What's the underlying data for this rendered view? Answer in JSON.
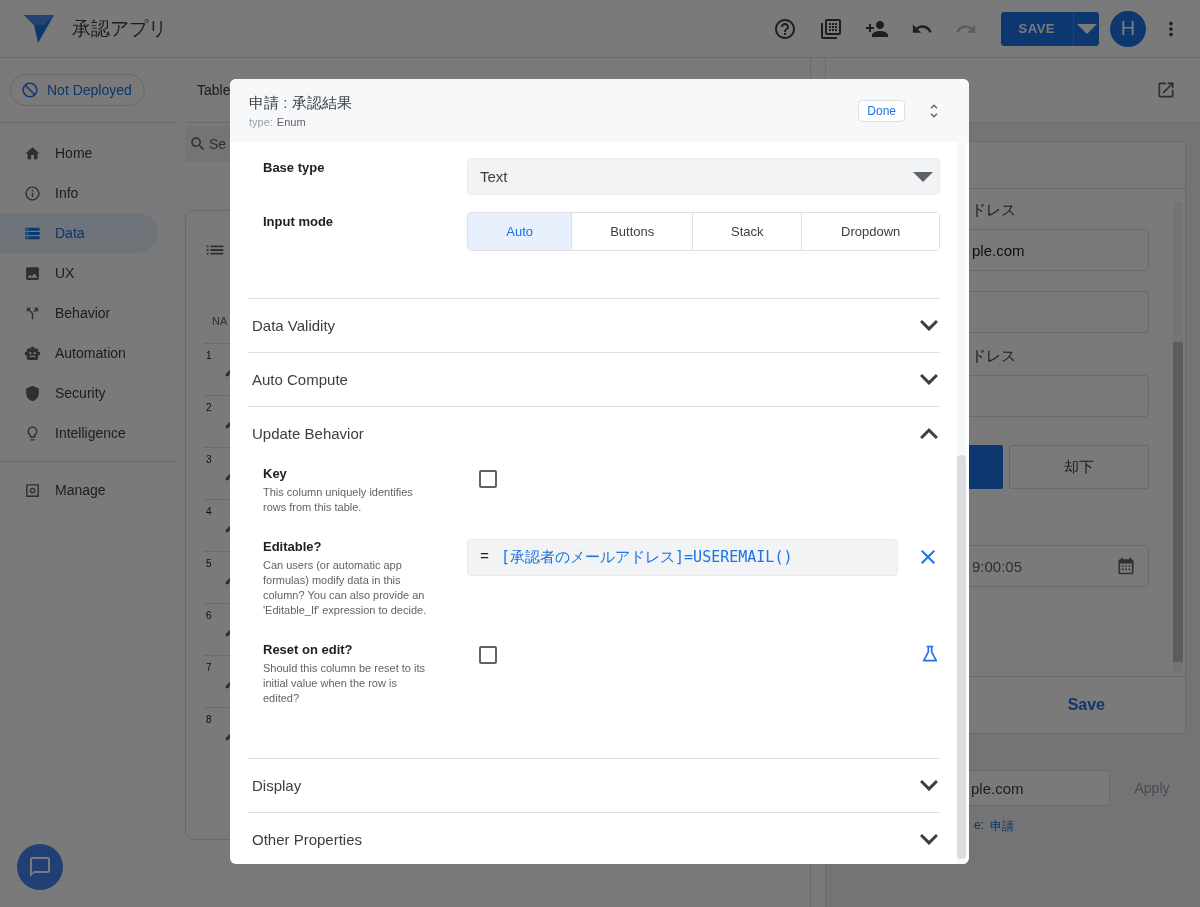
{
  "app": {
    "title": "承認アプリ",
    "save_button": "SAVE",
    "avatar": "H"
  },
  "sidebar": {
    "deploy_status": "Not Deployed",
    "items": [
      {
        "label": "Home",
        "selected": false
      },
      {
        "label": "Info",
        "selected": false
      },
      {
        "label": "Data",
        "selected": true
      },
      {
        "label": "UX",
        "selected": false
      },
      {
        "label": "Behavior",
        "selected": false
      },
      {
        "label": "Automation",
        "selected": false
      },
      {
        "label": "Security",
        "selected": false
      },
      {
        "label": "Intelligence",
        "selected": false
      }
    ],
    "footer_items": [
      {
        "label": "Manage",
        "selected": false
      }
    ]
  },
  "center": {
    "tab": "Table",
    "search": {
      "placeholder": "Se"
    },
    "table": {
      "column_1": "NA",
      "row_numbers": [
        "1",
        "2",
        "3",
        "4",
        "5",
        "6",
        "7",
        "8"
      ]
    }
  },
  "preview": {
    "form": [
      {
        "kind": "label",
        "text": "ドレス"
      },
      {
        "kind": "field",
        "value": "ple.com"
      },
      {
        "kind": "field"
      },
      {
        "kind": "label",
        "text": "ドレス"
      },
      {
        "kind": "field"
      },
      {
        "kind": "buttons",
        "buttons": [
          {
            "selected": true
          },
          {
            "label": "却下",
            "selected": false
          }
        ]
      },
      {
        "kind": "date",
        "value": "9:00:05"
      }
    ],
    "save_button": "Save",
    "email_field": "ple.com",
    "apply_button": {
      "label": "Apply",
      "disabled": true
    },
    "table_ref_label": "e:",
    "table_ref_link": "申請"
  },
  "dialog": {
    "title": "申請 : 承認結果",
    "type_label": "type:",
    "type_value": "Enum",
    "done_button": "Done",
    "base_type": {
      "label": "Base type",
      "value": "Text"
    },
    "input_mode": {
      "label": "Input mode",
      "options": [
        {
          "label": "Auto",
          "selected": true
        },
        {
          "label": "Buttons",
          "selected": false
        },
        {
          "label": "Stack",
          "selected": false
        },
        {
          "label": "Dropdown",
          "selected": false
        }
      ]
    },
    "sections": [
      {
        "title": "Data Validity",
        "expanded": false
      },
      {
        "title": "Auto Compute",
        "expanded": false
      },
      {
        "title": "Update Behavior",
        "expanded": true,
        "settings": [
          {
            "kind": "checkbox",
            "label": "Key",
            "description": "This column uniquely identifies rows from this table.",
            "checked": false,
            "test_button": false
          },
          {
            "kind": "formula",
            "label": "Editable?",
            "description": "Can users (or automatic app formulas) modify data in this column? You can also provide an 'Editable_If' expression to decide.",
            "prefix": "=",
            "value": "[承認者のメールアドレス]=USEREMAIL()"
          },
          {
            "kind": "checkbox",
            "label": "Reset on edit?",
            "description": "Should this column be reset to its initial value when the row is edited?",
            "checked": false,
            "test_button": true
          }
        ]
      },
      {
        "title": "Display",
        "expanded": false
      },
      {
        "title": "Other Properties",
        "expanded": false
      }
    ]
  }
}
